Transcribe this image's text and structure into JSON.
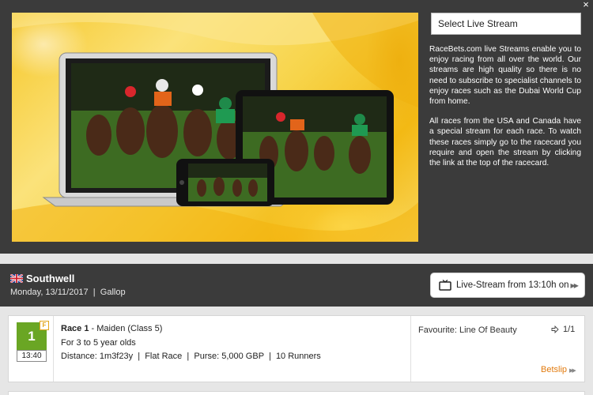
{
  "modal": {
    "close_glyph": "×",
    "select_label": "Select Live Stream",
    "description": [
      "RaceBets.com live Streams enable you to enjoy racing from all over the world. Our streams are high quality so there is no need to subscribe to specialist channels to enjoy races such as the Dubai World Cup from home.",
      "All races from the USA and Canada have a special stream for each race. To watch these races simply go to the racecard you require and open the stream by clicking the link at the top of the racecard."
    ]
  },
  "meeting": {
    "country_icon": "uk-flag-icon",
    "venue": "Southwell",
    "date": "Monday, 13/11/2017",
    "separator": "|",
    "race_type": "Gallop",
    "live_stream_label": "Live-Stream from 13:10h on",
    "live_stream_icon": "tv-icon"
  },
  "race": {
    "number": "1",
    "badge": "F",
    "time": "13:40",
    "name": "Race 1",
    "class_text": " - Maiden (Class 5)",
    "ages": "For 3 to 5 year olds",
    "distance": "Distance: 1m3f23y",
    "race_kind": "Flat Race",
    "purse": "Purse: 5,000 GBP",
    "runners": "10 Runners",
    "favourite": "Favourite: Line Of Beauty",
    "favourite_odds": "1/1",
    "betslip_label": "Betslip"
  },
  "colors": {
    "panel": "#3b3b3b",
    "race_green": "#6aa624",
    "betslip_orange": "#e27b0f",
    "promo_yellow": "#f6c82c"
  }
}
